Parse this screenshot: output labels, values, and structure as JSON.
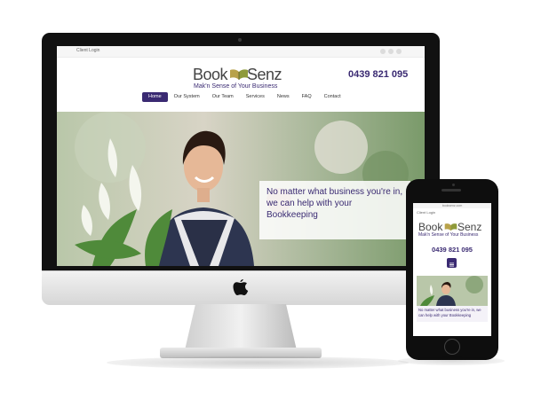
{
  "site": {
    "client_login": "Client Login",
    "logo_left": "Book",
    "logo_right": "Senz",
    "tagline": "Mak'n Sense of Your Business",
    "phone": "0439 821 095",
    "nav": [
      "Home",
      "Our System",
      "Our Team",
      "Services",
      "News",
      "FAQ",
      "Contact"
    ],
    "hero_caption": "No matter what business you're in, we can help with your Bookkeeping"
  },
  "mobile": {
    "url": "booksenz.com",
    "client_login": "Client Login",
    "logo_left": "Book",
    "logo_right": "Senz",
    "tagline": "Mak'n Sense of Your Business",
    "phone": "0439 821 095",
    "hero_caption": "No matter what business you're in, we can help with your Bookkeeping"
  },
  "colors": {
    "brand_purple": "#3a2a72",
    "device_black": "#111111",
    "aluminium": "#d6d6d6"
  }
}
